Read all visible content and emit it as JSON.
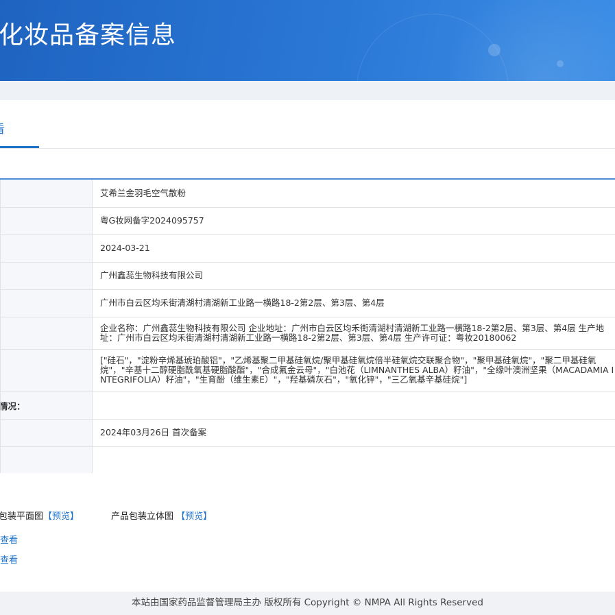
{
  "banner": {
    "title": "化妆品备案信息"
  },
  "tabs": {
    "active_label": "看"
  },
  "rows": [
    {
      "label": "",
      "value": "艾希兰金羽毛空气散粉"
    },
    {
      "label": "",
      "value": "粤G妆网备字2024095757"
    },
    {
      "label": "",
      "value": "2024-03-21"
    },
    {
      "label": "",
      "value": "广州鑫蕊生物科技有限公司"
    },
    {
      "label": "",
      "value": "广州市白云区均禾街清湖村清湖新工业路一横路18-2第2层、第3层、第4层"
    },
    {
      "label": "",
      "value": "企业名称：广州鑫蕊生物科技有限公司 企业地址：广州市白云区均禾街清湖村清湖新工业路一横路18-2第2层、第3层、第4层 生产地址：广州市白云区均禾街清湖村清湖新工业路一横路18-2第2层、第3层、第4层 生产许可证：粤妆20180062"
    },
    {
      "label": "",
      "value": "[\"硅石\"，\"淀粉辛烯基琥珀酸铝\"，\"乙烯基聚二甲基硅氧烷/聚甲基硅氧烷倍半硅氧烷交联聚合物\"，\"聚甲基硅氧烷\"，\"聚二甲基硅氧烷\"，\"辛基十二醇硬脂酰氧基硬脂酸酯\"，\"合成氟金云母\"，\"白池花（LIMNANTHES ALBA）籽油\"，\"全缘叶澳洲坚果（MACADAMIA INTEGRIFOLIA）籽油\"，\"生育酚（维生素E）\"，\"羟基磷灰石\"，\"氧化锌\"，\"三乙氧基辛基硅烷\"]"
    },
    {
      "label": "情况：",
      "value": ""
    },
    {
      "label": "",
      "value": "2024年03月26日 首次备案"
    },
    {
      "label": "",
      "value": ""
    }
  ],
  "packaging": {
    "flat_label": "包装平面图",
    "flat_link": "【预览】",
    "stereo_label": "产品包装立体图 ",
    "stereo_link": "【预览】"
  },
  "view_links": [
    "查看",
    "查看"
  ],
  "footer": {
    "text": "本站由国家药品监督管理局主办 版权所有 Copyright © NMPA All Rights Reserved"
  }
}
